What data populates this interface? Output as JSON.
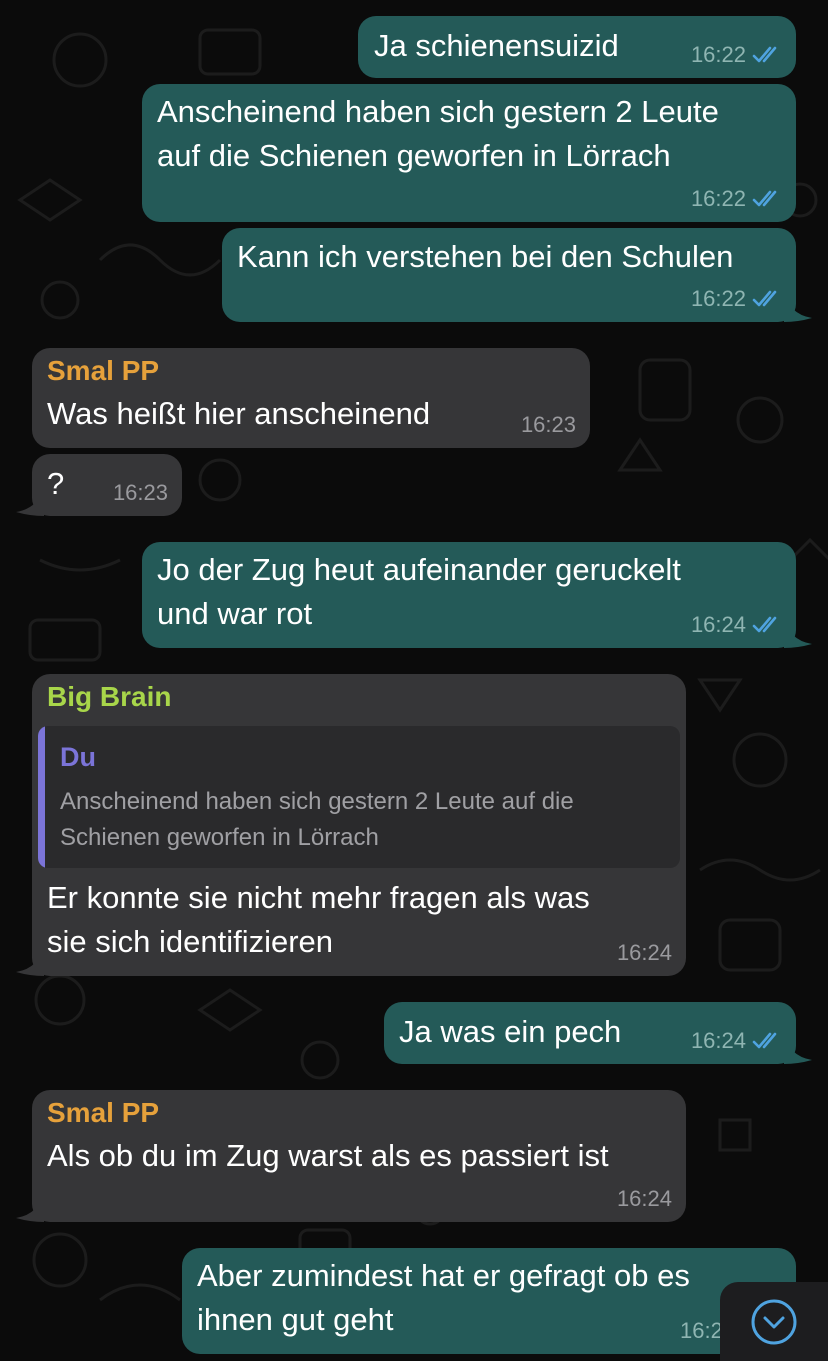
{
  "messages": [
    {
      "direction": "outgoing",
      "text_lines": [
        "Ja schienensuizid"
      ],
      "time": "16:22",
      "status": "read"
    },
    {
      "direction": "outgoing",
      "text_lines": [
        "Anscheinend haben sich gestern 2 Leute",
        "auf die Schienen geworfen in Lörrach"
      ],
      "time": "16:22",
      "status": "read"
    },
    {
      "direction": "outgoing",
      "text_lines": [
        "Kann ich verstehen bei den Schulen"
      ],
      "time": "16:22",
      "status": "read"
    },
    {
      "direction": "incoming",
      "sender": "Smal PP",
      "sender_color": "#e6a13b",
      "text_lines": [
        "Was heißt hier anscheinend"
      ],
      "time": "16:23"
    },
    {
      "direction": "incoming",
      "text_lines": [
        "?"
      ],
      "time": "16:23"
    },
    {
      "direction": "outgoing",
      "text_lines": [
        "Jo der Zug heut aufeinander geruckelt",
        "und war rot"
      ],
      "time": "16:24",
      "status": "read"
    },
    {
      "direction": "incoming",
      "sender": "Big Brain",
      "sender_color": "#a8d64a",
      "quote": {
        "author": "Du",
        "text_lines": [
          "Anscheinend haben sich gestern 2 Leute auf die",
          "Schienen geworfen in Lörrach"
        ]
      },
      "text_lines": [
        "Er konnte sie nicht mehr fragen als was",
        "sie sich identifizieren"
      ],
      "time": "16:24"
    },
    {
      "direction": "outgoing",
      "text_lines": [
        "Ja was ein pech"
      ],
      "time": "16:24",
      "status": "read"
    },
    {
      "direction": "incoming",
      "sender": "Smal PP",
      "sender_color": "#e6a13b",
      "text_lines": [
        "Als ob du im Zug warst als es passiert ist"
      ],
      "time": "16:24"
    },
    {
      "direction": "outgoing",
      "text_lines": [
        "Aber zumindest hat er gefragt ob es",
        "ihnen gut geht"
      ],
      "time": "16:2"
    }
  ],
  "scroll_button": {
    "icon": "chevron-down-icon"
  },
  "colors": {
    "background": "#0b0b0b",
    "outgoing_bubble": "#245a58",
    "incoming_bubble": "#363638",
    "read_ticks": "#4fa3e0",
    "quote_accent": "#7b74d8"
  }
}
